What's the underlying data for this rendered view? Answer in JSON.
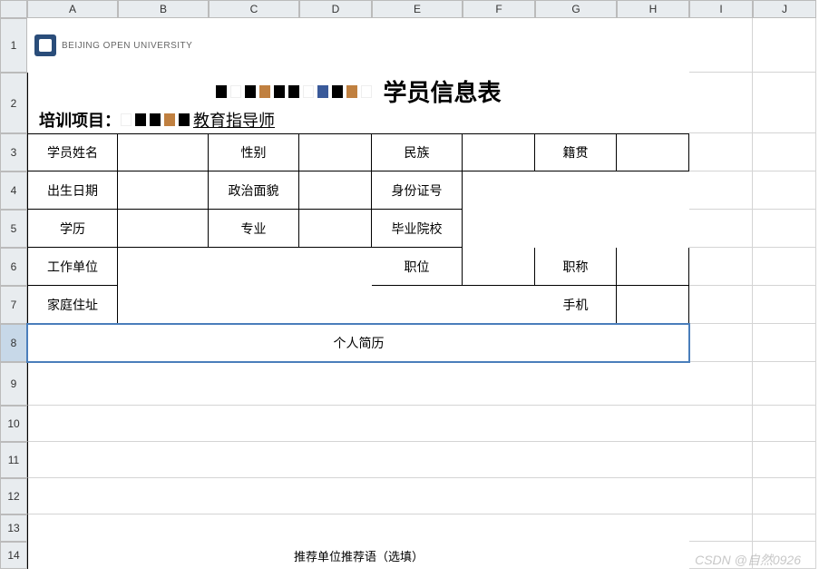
{
  "columns": [
    "A",
    "B",
    "C",
    "D",
    "E",
    "F",
    "G",
    "H",
    "I",
    "J"
  ],
  "rows": [
    "1",
    "2",
    "3",
    "4",
    "5",
    "6",
    "7",
    "8",
    "9",
    "10",
    "11",
    "12",
    "13",
    "14"
  ],
  "logo_text": "BEIJING OPEN UNIVERSITY",
  "title_suffix": "学员信息表",
  "project": {
    "label": "培训项目：",
    "value_suffix": "教育指导师"
  },
  "form": {
    "r3": {
      "c1": "学员姓名",
      "c3": "性别",
      "c5": "民族",
      "c7": "籍贯"
    },
    "r4": {
      "c1": "出生日期",
      "c3": "政治面貌",
      "c5": "身份证号"
    },
    "r5": {
      "c1": "学历",
      "c3": "专业",
      "c5": "毕业院校"
    },
    "r6": {
      "c1": "工作单位",
      "c5": "职位",
      "c7": "职称"
    },
    "r7": {
      "c1": "家庭住址",
      "c7": "手机"
    },
    "r8": "个人简历",
    "r14": "推荐单位推荐语（选填）"
  },
  "selected_row": "8",
  "watermark": "CSDN @自然0926"
}
